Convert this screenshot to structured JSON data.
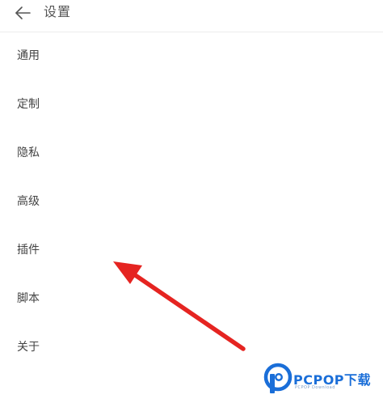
{
  "header": {
    "title": "设置",
    "back_icon": "arrow-left-icon"
  },
  "menu": {
    "items": [
      {
        "label": "通用"
      },
      {
        "label": "定制"
      },
      {
        "label": "隐私"
      },
      {
        "label": "高级"
      },
      {
        "label": "插件"
      },
      {
        "label": "脚本"
      },
      {
        "label": "关于"
      }
    ]
  },
  "annotation": {
    "arrow_color": "#e52421",
    "points_to": "插件"
  },
  "watermark": {
    "brand": "PCPOP下载",
    "sub": "PCPOP Download",
    "color": "#1a6ed8"
  }
}
